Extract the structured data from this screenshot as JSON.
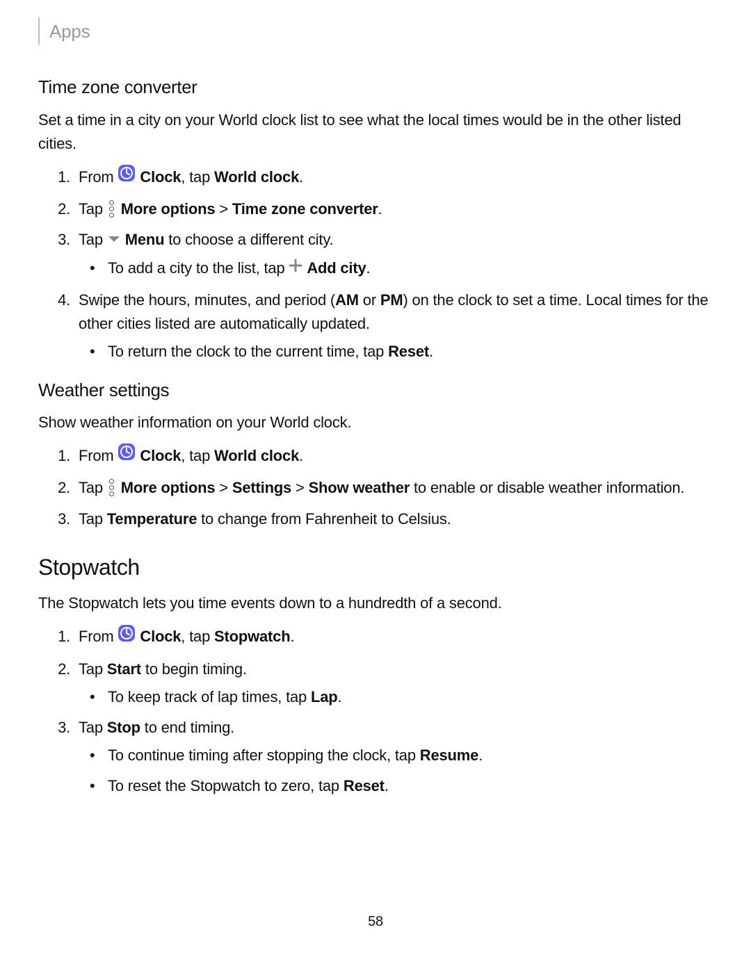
{
  "header": {
    "title": "Apps"
  },
  "pagenum": "58",
  "tzc": {
    "heading": "Time zone converter",
    "intro": "Set a time in a city on your World clock list to see what the local times would be in the other listed cities.",
    "s1_from": "From ",
    "s1_clock": "Clock",
    "s1_tap": ", tap ",
    "s1_world": "World clock",
    "s2_tap": "Tap ",
    "s2_more": "More options",
    "s2_gt": " > ",
    "s2_tzc": "Time zone converter",
    "s3_tap": "Tap ",
    "s3_menu": "Menu",
    "s3_rest": " to choose a different city.",
    "s3b_pre": "To add a city to the list, tap ",
    "s3b_add": "Add city",
    "s4_pre": "Swipe the hours, minutes, and period (",
    "s4_am": "AM",
    "s4_or": " or ",
    "s4_pm": "PM",
    "s4_post": ") on the clock to set a time. Local times for the other cities listed are automatically updated.",
    "s4b_pre": "To return the clock to the current time, tap ",
    "s4b_reset": "Reset"
  },
  "ws": {
    "heading": "Weather settings",
    "intro": "Show weather information on your World clock.",
    "s1_from": "From ",
    "s1_clock": "Clock",
    "s1_tap": ", tap ",
    "s1_world": "World clock",
    "s2_tap": "Tap ",
    "s2_more": "More options",
    "s2_gt1": " > ",
    "s2_settings": "Settings",
    "s2_gt2": " > ",
    "s2_show": "Show weather",
    "s2_rest": " to enable or disable weather information.",
    "s3_tap": "Tap ",
    "s3_temp": "Temperature",
    "s3_rest": " to change from Fahrenheit to Celsius."
  },
  "sw": {
    "heading": "Stopwatch",
    "intro": "The Stopwatch lets you time events down to a hundredth of a second.",
    "s1_from": "From ",
    "s1_clock": "Clock",
    "s1_tap": ", tap ",
    "s1_sw": "Stopwatch",
    "s2_tap": "Tap ",
    "s2_start": "Start",
    "s2_rest": " to begin timing.",
    "s2b_pre": "To keep track of lap times, tap ",
    "s2b_lap": "Lap",
    "s3_tap": "Tap ",
    "s3_stop": "Stop",
    "s3_rest": " to end timing.",
    "s3b1_pre": "To continue timing after stopping the clock, tap ",
    "s3b1_resume": "Resume",
    "s3b2_pre": "To reset the Stopwatch to zero, tap ",
    "s3b2_reset": "Reset"
  }
}
